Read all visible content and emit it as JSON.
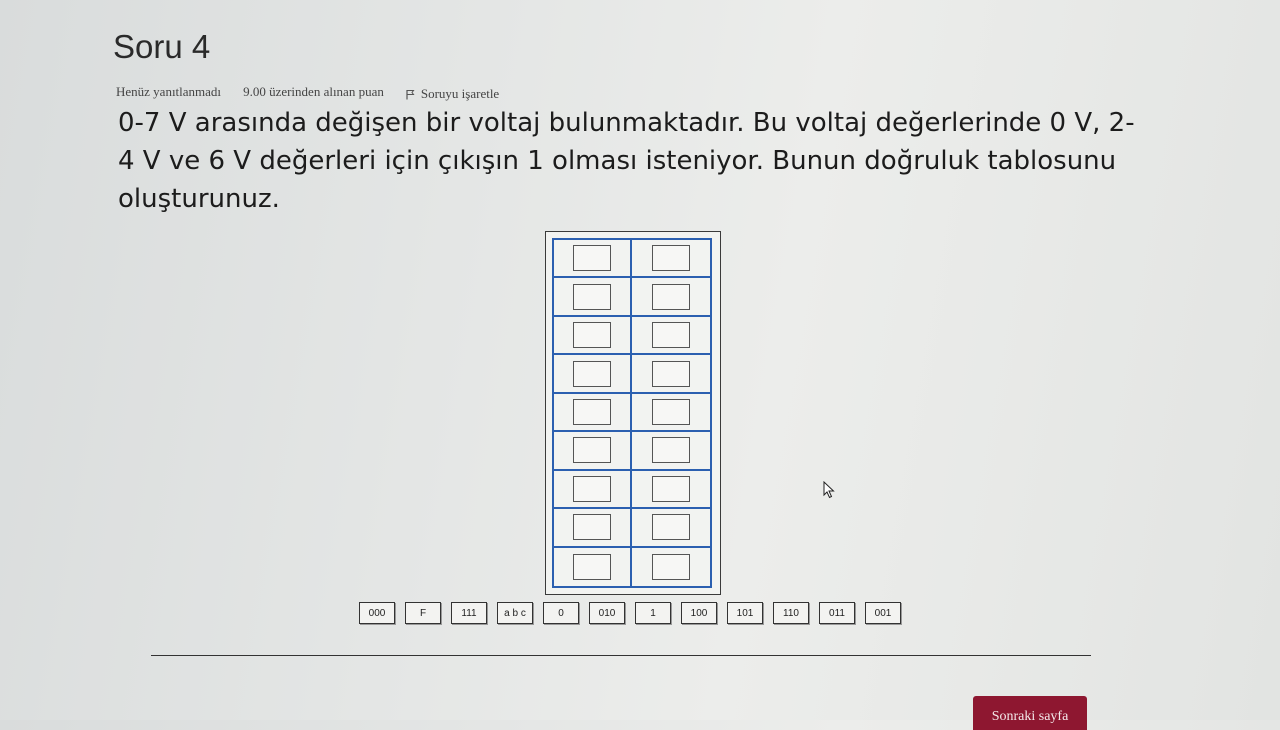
{
  "question": {
    "title": "Soru 4",
    "status": "Henüz yanıtlanmadı",
    "points": "9.00 üzerinden alınan puan",
    "flag_label": "Soruyu işaretle",
    "text": "0-7 V arasında değişen bir voltaj bulunmaktadır. Bu voltaj değerlerinde 0 V, 2-4 V ve 6 V değerleri için çıkışın 1 olması isteniyor. Bunun doğruluk tablosunu oluşturunuz."
  },
  "truth_table": {
    "rows": 9,
    "columns": 2
  },
  "chips": [
    "000",
    "F",
    "111",
    "a b c",
    "0",
    "010",
    "1",
    "100",
    "101",
    "110",
    "011",
    "001"
  ],
  "navigation": {
    "next_label": "Sonraki sayfa"
  },
  "colors": {
    "table_border": "#2b5fb0",
    "next_button": "#8e1730"
  },
  "icons": {
    "flag": "flag-icon",
    "cursor": "mouse-cursor-icon"
  }
}
